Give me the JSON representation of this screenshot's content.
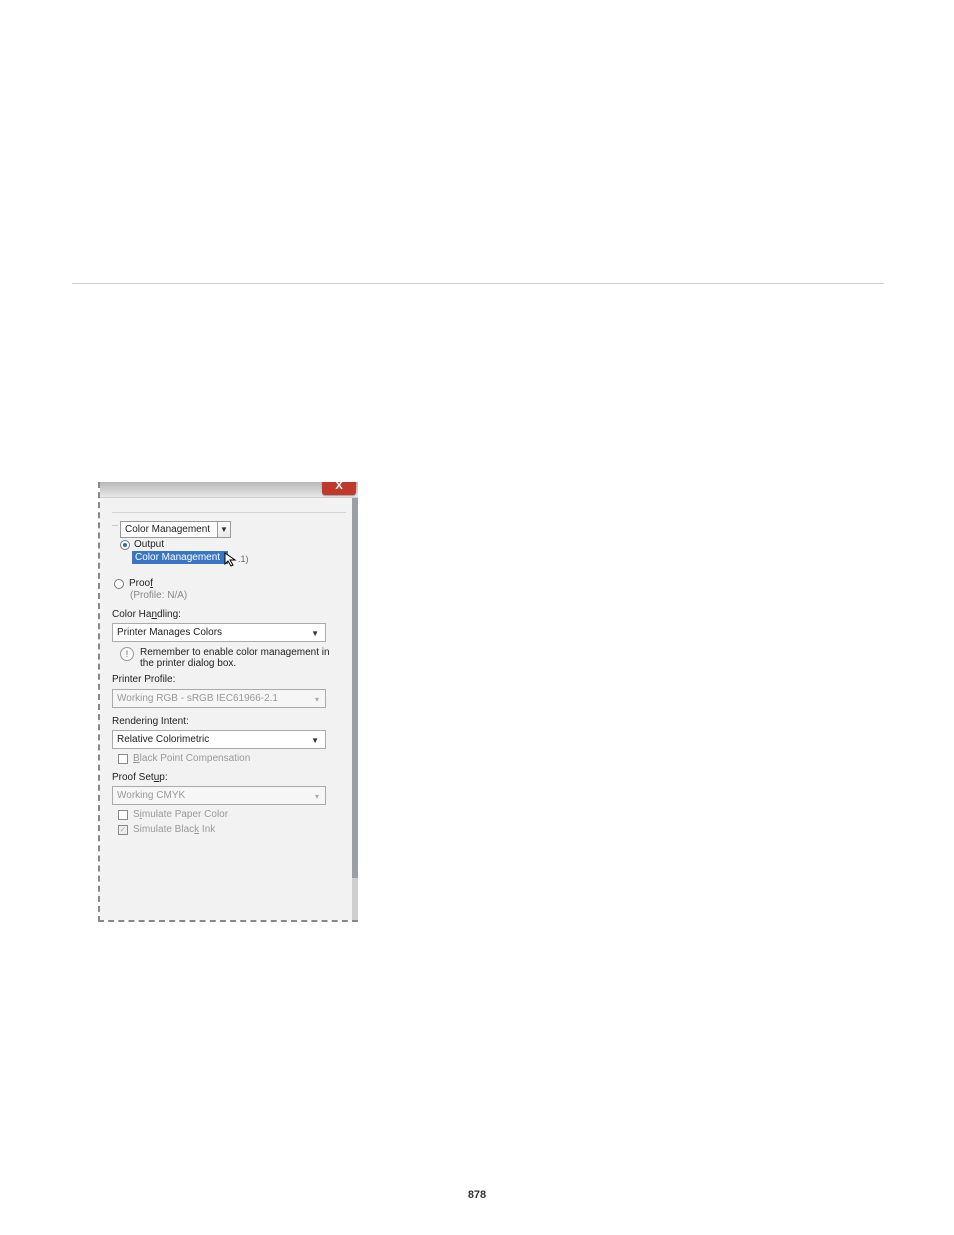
{
  "page_number": "878",
  "dialog": {
    "close_glyph": "X",
    "section_dropdown": {
      "value": "Color Management",
      "options": [
        "Output",
        "Color Management"
      ],
      "selected_index": 1,
      "tail_text": ".1)"
    },
    "proof": {
      "label_pre": "Proo",
      "label_underlined": "f",
      "profile_note": "(Profile: N/A)"
    },
    "color_handling": {
      "label_pre": "Color Ha",
      "label_mid_underlined": "n",
      "label_post": "dling:",
      "value": "Printer Manages Colors"
    },
    "reminder": {
      "icon": "!",
      "text": "Remember to enable color management in the printer dialog box."
    },
    "printer_profile": {
      "label": "Printer Profile:",
      "value": "Working RGB - sRGB IEC61966-2.1"
    },
    "rendering_intent": {
      "label": "Rendering Intent:",
      "value": "Relative Colorimetric"
    },
    "bpc": {
      "pre": "B",
      "post": "lack Point Compensation"
    },
    "proof_setup": {
      "label_pre": "Proof Set",
      "label_mid_underlined": "u",
      "label_post": "p:",
      "value": "Working CMYK"
    },
    "sim_paper": {
      "pre": "S",
      "mid_underlined": "i",
      "post": "mulate Paper Color"
    },
    "sim_black": {
      "pre": "Simulate Blac",
      "mid_underlined": "k",
      "post": " Ink"
    }
  }
}
